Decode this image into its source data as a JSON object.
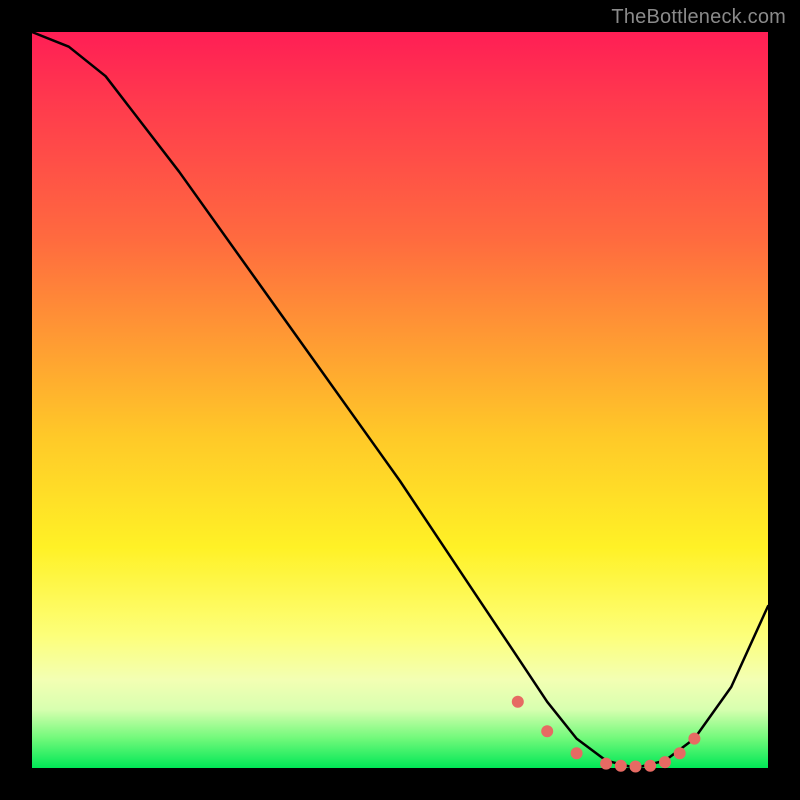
{
  "watermark": "TheBottleneck.com",
  "chart_data": {
    "type": "line",
    "title": "",
    "xlabel": "",
    "ylabel": "",
    "xlim": [
      0,
      100
    ],
    "ylim": [
      0,
      100
    ],
    "grid": false,
    "series": [
      {
        "name": "bottleneck-curve",
        "x": [
          0,
          5,
          10,
          20,
          30,
          40,
          50,
          60,
          66,
          70,
          74,
          78,
          82,
          86,
          90,
          95,
          100
        ],
        "values": [
          100,
          98,
          94,
          81,
          67,
          53,
          39,
          24,
          15,
          9,
          4,
          1,
          0,
          1,
          4,
          11,
          22
        ]
      }
    ],
    "highlight_band": {
      "name": "optimal-range-dots",
      "x": [
        66,
        70,
        74,
        78,
        80,
        82,
        84,
        86,
        88,
        90
      ],
      "values": [
        9,
        5,
        2,
        0.6,
        0.3,
        0.2,
        0.3,
        0.8,
        2,
        4
      ]
    }
  },
  "colors": {
    "curve": "#000000",
    "dots": "#e66a63",
    "background_top": "#ff1e55",
    "background_bottom": "#00e756",
    "frame": "#000000",
    "watermark": "#8a8a8a"
  }
}
